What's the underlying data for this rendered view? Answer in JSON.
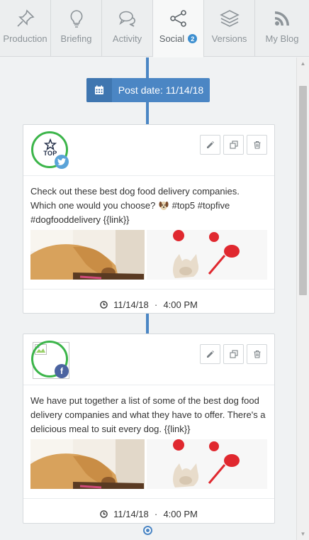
{
  "tabs": [
    {
      "label": "Production",
      "icon": "pin-icon"
    },
    {
      "label": "Briefing",
      "icon": "lightbulb-icon"
    },
    {
      "label": "Activity",
      "icon": "chat-bubbles-icon"
    },
    {
      "label": "Social",
      "icon": "share-icon",
      "badge": "2",
      "active": true
    },
    {
      "label": "Versions",
      "icon": "layers-icon"
    },
    {
      "label": "My Blog",
      "icon": "rss-icon"
    }
  ],
  "post_date": {
    "label": "Post date: 11/14/18"
  },
  "posts": [
    {
      "network": "twitter",
      "avatar_text": "TOP",
      "text_before_emoji": "Check out these best dog food delivery companies. Which one would you choose?",
      "text_after_emoji": "#top5 #topfive #dogfooddelivery {{link}}",
      "date": "11/14/18",
      "time": "4:00 PM"
    },
    {
      "network": "facebook",
      "text_before_emoji": "We have put together a list of some of the best dog food delivery companies and what they have to offer. There's a delicious meal to suit every dog. {{link}}",
      "text_after_emoji": "",
      "date": "11/14/18",
      "time": "4:00 PM"
    }
  ],
  "colors": {
    "accent": "#4b86c4",
    "active_ring": "#3cb54a",
    "twitter": "#5aa3d8",
    "facebook": "#4b63a0"
  }
}
